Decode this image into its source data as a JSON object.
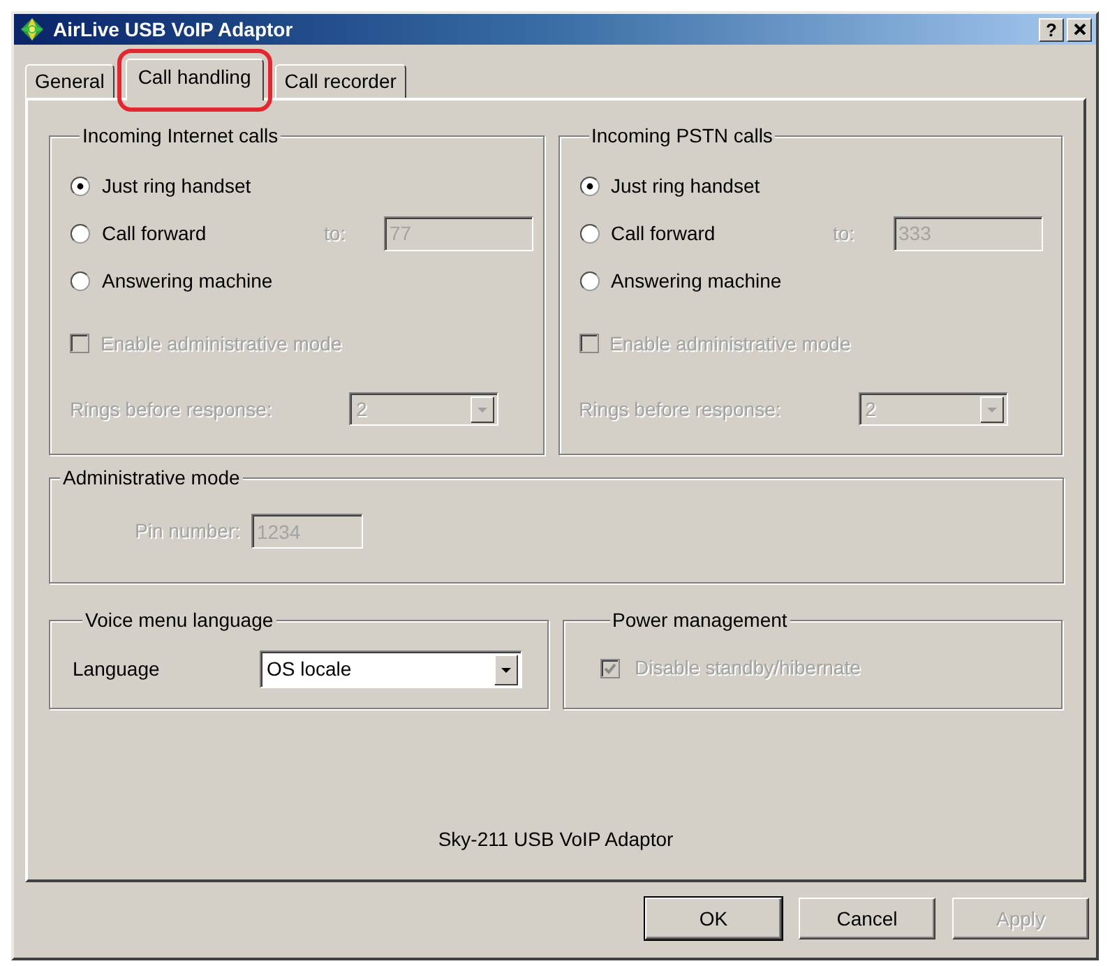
{
  "window": {
    "title": "AirLive USB VoIP Adaptor",
    "help_button": "?"
  },
  "tabs": [
    {
      "label": "General",
      "selected": false,
      "highlighted": false
    },
    {
      "label": "Call handling",
      "selected": true,
      "highlighted": true
    },
    {
      "label": "Call recorder",
      "selected": false,
      "highlighted": false
    }
  ],
  "incoming": [
    {
      "title": "Incoming Internet calls",
      "options": [
        {
          "label": "Just ring handset",
          "selected": true
        },
        {
          "label": "Call forward",
          "selected": false
        },
        {
          "label": "Answering machine",
          "selected": false
        }
      ],
      "forward": {
        "label": "to:",
        "value": "77",
        "disabled": true
      },
      "admin_checkbox": {
        "label": "Enable administrative mode",
        "checked": false,
        "disabled": true
      },
      "rings": {
        "label": "Rings before response:",
        "value": "2",
        "disabled": true
      }
    },
    {
      "title": "Incoming PSTN calls",
      "options": [
        {
          "label": "Just ring handset",
          "selected": true
        },
        {
          "label": "Call forward",
          "selected": false
        },
        {
          "label": "Answering machine",
          "selected": false
        }
      ],
      "forward": {
        "label": "to:",
        "value": "333",
        "disabled": true
      },
      "admin_checkbox": {
        "label": "Enable administrative mode",
        "checked": false,
        "disabled": true
      },
      "rings": {
        "label": "Rings before response:",
        "value": "2",
        "disabled": true
      }
    }
  ],
  "administrative_mode": {
    "title": "Administrative mode",
    "pin": {
      "label": "Pin number:",
      "value": "1234",
      "disabled": true
    }
  },
  "voice_menu": {
    "title": "Voice menu language",
    "language": {
      "label": "Language",
      "value": "OS locale",
      "disabled": false
    }
  },
  "power_management": {
    "title": "Power management",
    "standby_checkbox": {
      "label": "Disable standby/hibernate",
      "checked": true,
      "disabled": true
    }
  },
  "footer": "Sky-211 USB VoIP Adaptor",
  "buttons": [
    {
      "label": "OK",
      "default": true,
      "disabled": false
    },
    {
      "label": "Cancel",
      "default": false,
      "disabled": false
    },
    {
      "label": "Apply",
      "default": false,
      "disabled": true
    }
  ]
}
